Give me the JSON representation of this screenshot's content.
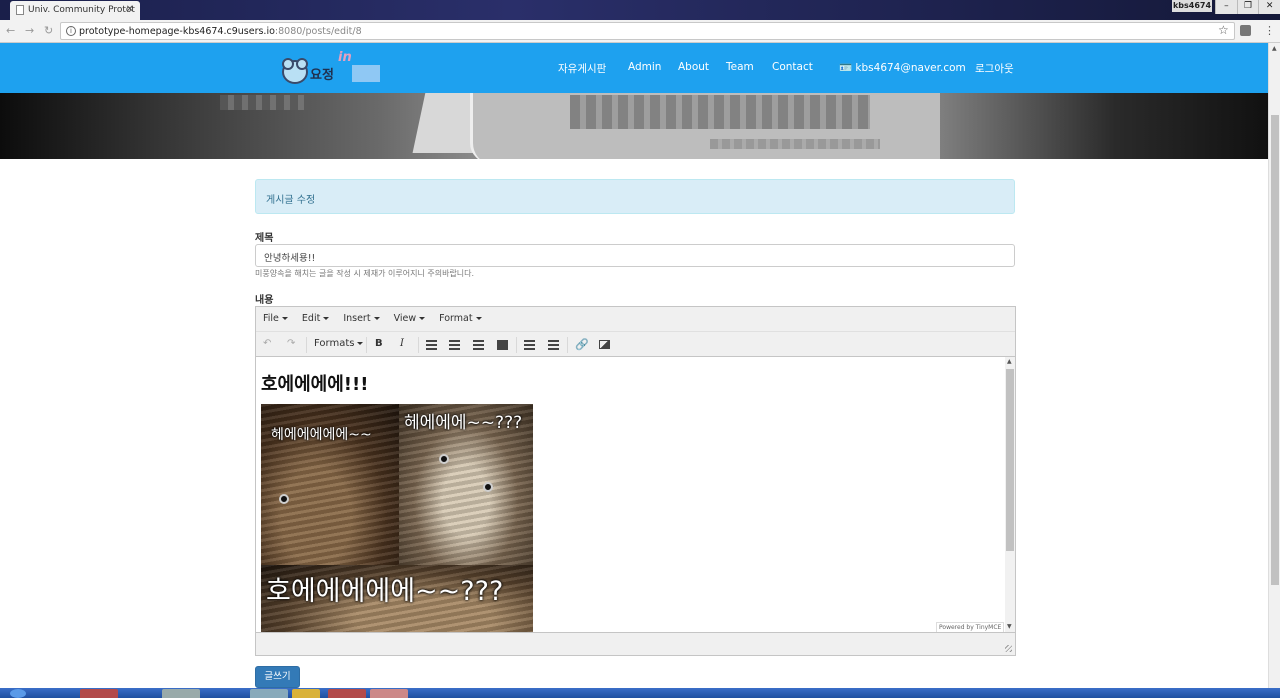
{
  "browser": {
    "tab_title": "Univ. Community Protot",
    "tab_close": "✕",
    "profile": "kbs4674",
    "url_host": "prototype-homepage-kbs4674.c9users.io",
    "url_rest": ":8080/posts/edit/8",
    "window_min": "–",
    "window_restore": "❐",
    "window_close": "✕"
  },
  "navbar": {
    "logo_text": "요정",
    "logo_sup": "in",
    "links": [
      "자유게시판",
      "Admin",
      "About",
      "Team",
      "Contact"
    ],
    "email": "kbs4674@naver.com",
    "logout": "로그아웃"
  },
  "form": {
    "header": "게시글 수정",
    "title_label": "제목",
    "title_value": "안녕하세용!!",
    "help_text": "미풍양속을 해치는 글을 작성 시 제재가 이루어지니 주의바랍니다.",
    "content_label": "내용",
    "submit_label": "글쓰기"
  },
  "editor": {
    "menus": [
      "File",
      "Edit",
      "Insert",
      "View",
      "Format"
    ],
    "formats_label": "Formats",
    "bold": "B",
    "italic": "I",
    "undo": "↶",
    "redo": "↷",
    "link": "🔗",
    "heading": "호에에에에!!!",
    "meme": {
      "top_left": "헤에에에에에~~",
      "top_right": "헤에에에~~???",
      "bottom": "호에에에에에~~???"
    },
    "powered": "Powered by TinyMCE"
  }
}
